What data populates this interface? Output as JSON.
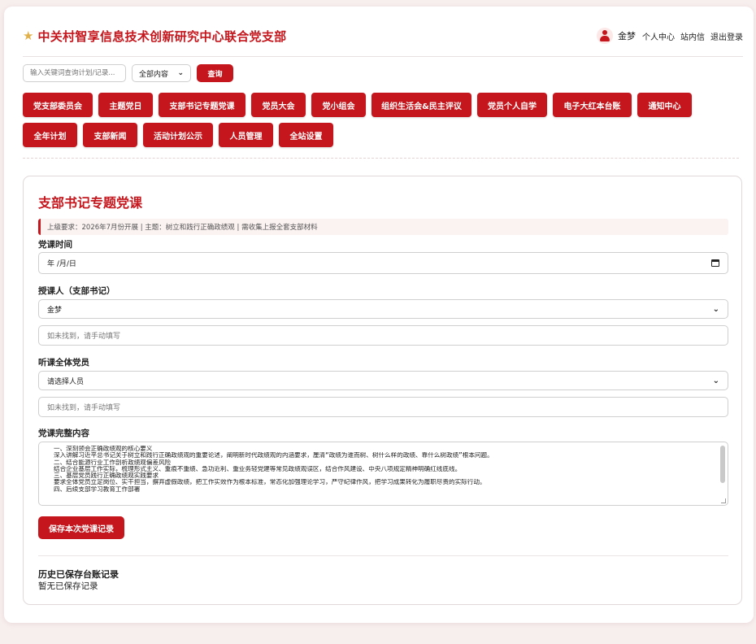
{
  "header": {
    "title": "中关村智享信息技术创新研究中心联合党支部",
    "user_name": "金梦",
    "links": [
      "个人中心",
      "站内信",
      "退出登录"
    ]
  },
  "search": {
    "placeholder": "输入关键词查询计划/记录...",
    "filter_selected": "全部内容",
    "query_label": "查询"
  },
  "nav": {
    "row1": [
      "党支部委员会",
      "主题党日",
      "支部书记专题党课",
      "党员大会",
      "党小组会",
      "组织生活会&民主评议",
      "党员个人自学",
      "电子大红本台账",
      "通知中心"
    ],
    "row2": [
      "全年计划",
      "支部新闻",
      "活动计划公示",
      "人员管理",
      "全站设置"
    ]
  },
  "form": {
    "title": "支部书记专题党课",
    "notice": "上级要求：2026年7月份开展 | 主题：树立和践行正确政绩观 | 需收集上报全套支部材料",
    "date_label": "党课时间",
    "date_value": "年 /月/日",
    "lecturer_label": "授课人（支部书记）",
    "lecturer_selected": "金梦",
    "lecturer_manual_placeholder": "如未找到，请手动填写",
    "attendees_label": "听课全体党员",
    "attendees_selected": "请选择人员",
    "attendees_manual_placeholder": "如未找到，请手动填写",
    "content_label": "党课完整内容",
    "content_lines": [
      "一、深刻领会正确政绩观的核心要义",
      "深入讲解习近平总书记关于树立和践行正确政绩观的重要论述，阐明新时代政绩观的内涵要求，厘清“政绩为谁而树、树什么样的政绩、靠什么树政绩”根本问题。",
      "二、结合能源行业工作剖析政绩观偏差风险",
      "结合企业基层工作实际，梳理形式主义、重痕不重绩、急功近利、重业务轻党建等常见政绩观误区，结合作风建设、中央八项规定精神明确红线底线。",
      "三、基层党员践行正确政绩观实践要求",
      "要求全体党员立足岗位、实干担当，摒弃虚假政绩，把工作实效作为根本标准，常态化加强理论学习，严守纪律作风，把学习成果转化为履职尽责的实际行动。",
      "四、后续支部学习教育工作部署"
    ],
    "save_label": "保存本次党课记录"
  },
  "history": {
    "title": "历史已保存台账记录",
    "empty_text": "暂无已保存记录"
  }
}
